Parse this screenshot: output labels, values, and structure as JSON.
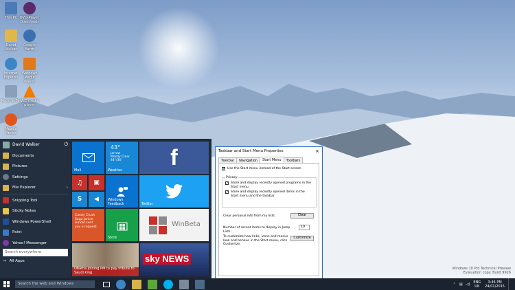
{
  "desktop": {
    "icons": [
      {
        "label": "This PC",
        "color": "#4b7ab8"
      },
      {
        "label": "DVD-Player Downloads",
        "color": "#5a2a6a"
      },
      {
        "label": "David Walker",
        "color": "#e0b84a"
      },
      {
        "label": "Google Earth",
        "color": "#3a6fb0"
      },
      {
        "label": "Internet Explorer",
        "color": "#3d86c6"
      },
      {
        "label": "Windows Media Player",
        "color": "#e07a1a"
      },
      {
        "label": "Recycle Bin",
        "color": "#8aa0b8"
      },
      {
        "label": "VLC media player",
        "color": "#f07d00"
      },
      {
        "label": "Mozilla Firefox",
        "color": "#e0561a"
      }
    ]
  },
  "start_menu": {
    "user_name": "David Walker",
    "items": [
      {
        "label": "Documents",
        "color": "#d9b24a",
        "arrow": ""
      },
      {
        "label": "Pictures",
        "color": "#d9b24a",
        "arrow": ""
      },
      {
        "label": "Settings",
        "color": "#6a7a8a",
        "arrow": ""
      },
      {
        "label": "File Explorer",
        "color": "#d9b24a",
        "arrow": "›"
      }
    ],
    "recent": [
      {
        "label": "Snipping Tool",
        "color": "#c8302a"
      },
      {
        "label": "Sticky Notes",
        "color": "#e8c84a"
      },
      {
        "label": "Windows PowerShell",
        "color": "#1f4f9a"
      },
      {
        "label": "Paint",
        "color": "#3a7ac8"
      },
      {
        "label": "Yahoo! Messenger",
        "color": "#7a3aa8"
      }
    ],
    "all_apps": "All Apps",
    "search_placeholder": "Search everywhere",
    "tiles": {
      "mail": "Mail",
      "weather_temp": "43°",
      "weather_place": "Jarrow",
      "weather_desc": "Mostly Clear",
      "weather_range": "44°/36°",
      "weather": "Weather",
      "windows_feedback": "Windows Feedback",
      "twitter": "Twitter",
      "candy_line1": "Candy Crush",
      "candy_line2": "Saga Janice",
      "candy_line3": "Arnold sent",
      "candy_line4": "you a request.",
      "store": "Store",
      "winbeta": "WinBeta",
      "news_caption": "Obama joining PM to pay tribute to Saudi king",
      "skynews": "sky NEWS"
    }
  },
  "dialog": {
    "title": "Taskbar and Start Menu Properties",
    "close": "×",
    "tabs": [
      "Taskbar",
      "Navigation",
      "Start Menu",
      "Toolbars"
    ],
    "use_start_menu": "Use the Start menu instead of the Start screen",
    "privacy_label": "Privacy",
    "store_programs": "Store and display recently opened programs in the Start menu",
    "store_items": "Store and display recently opened items in the Start menu and the taskbar",
    "clear_text": "Clear personal info from my lists:",
    "clear_btn": "Clear",
    "recent_items_label": "Number of recent items to display in Jump Lists:",
    "recent_items_value": "10",
    "customize_text": "To customize how links, icons and menus look and behave in the Start menu, click Customize.",
    "customize_btn": "Customize",
    "check": "✓"
  },
  "taskbar": {
    "search_placeholder": "Search the web and Windows",
    "apps": [
      {
        "name": "task-view",
        "color": "#ffffff"
      },
      {
        "name": "internet-explorer",
        "color": "#3d86c6"
      },
      {
        "name": "file-explorer",
        "color": "#d9b24a"
      },
      {
        "name": "store",
        "color": "#5aa83a"
      },
      {
        "name": "skype",
        "color": "#00aff0"
      },
      {
        "name": "network",
        "color": "#7a8a9a"
      },
      {
        "name": "monitor",
        "color": "#4a6a8a"
      }
    ],
    "lang": "ENG",
    "region": "UK",
    "time": "3:46 PM",
    "date": "24/01/2015"
  },
  "watermark": {
    "line1": "Windows 10 Pro Technical Preview",
    "line2": "Evaluation copy. Build 9926"
  }
}
